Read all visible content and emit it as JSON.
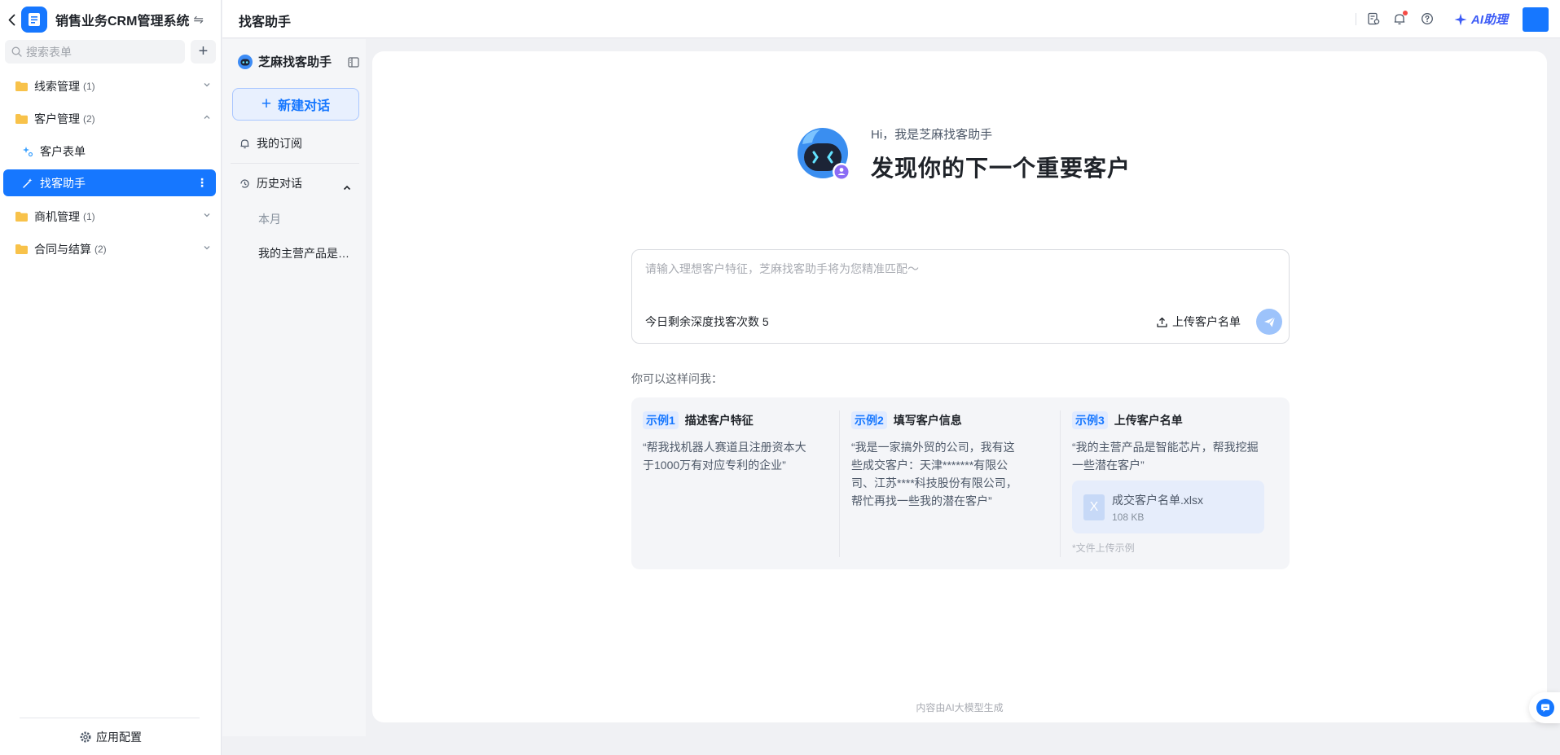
{
  "app": {
    "title": "销售业务CRM管理系统",
    "search_placeholder": "搜索表单",
    "footer_config": "应用配置",
    "accent_color": "#1677ff"
  },
  "sidebar": {
    "items": [
      {
        "label": "线索管理",
        "count": "(1)",
        "expanded": false
      },
      {
        "label": "客户管理",
        "count": "(2)",
        "expanded": true
      },
      {
        "label": "客户表单",
        "sub": true
      },
      {
        "label": "找客助手",
        "sub": true,
        "active": true
      },
      {
        "label": "商机管理",
        "count": "(1)",
        "expanded": false
      },
      {
        "label": "合同与结算",
        "count": "(2)",
        "expanded": false
      }
    ]
  },
  "topbar": {
    "title": "找客助手",
    "ai_label": "AI助理",
    "icons": [
      "report-icon",
      "notification-bell-icon",
      "help-icon"
    ]
  },
  "assistant_panel": {
    "title": "芝麻找客助手",
    "new_chat": "新建对话",
    "subscriptions": "我的订阅",
    "history": "历史对话",
    "period": "本月",
    "history_items": [
      "我的主营产品是智能芯片，帮我挖掘一些潜在客户"
    ]
  },
  "main": {
    "greeting": "Hi，我是芝麻找客助手",
    "headline": "发现你的下一个重要客户",
    "input_placeholder": "请输入理想客户特征，芝麻找客助手将为您精准匹配～",
    "remaining": "今日剩余深度找客次数 5",
    "upload_label": "上传客户名单",
    "ask_hint": "你可以这样问我：",
    "examples": [
      {
        "tag": "示例1",
        "title": "描述客户特征",
        "body": "“帮我找机器人赛道且注册资本大于1000万有对应专利的企业”"
      },
      {
        "tag": "示例2",
        "title": "填写客户信息",
        "body": "“我是一家搞外贸的公司，我有这些成交客户：天津*******有限公司、江苏****科技股份有限公司，帮忙再找一些我的潜在客户”"
      },
      {
        "tag": "示例3",
        "title": "上传客户名单",
        "body": "“我的主营产品是智能芯片，帮我挖掘一些潜在客户”"
      }
    ],
    "file": {
      "name": "成交客户名单.xlsx",
      "size": "108 KB",
      "note": "*文件上传示例"
    },
    "footnote": "内容由AI大模型生成"
  }
}
